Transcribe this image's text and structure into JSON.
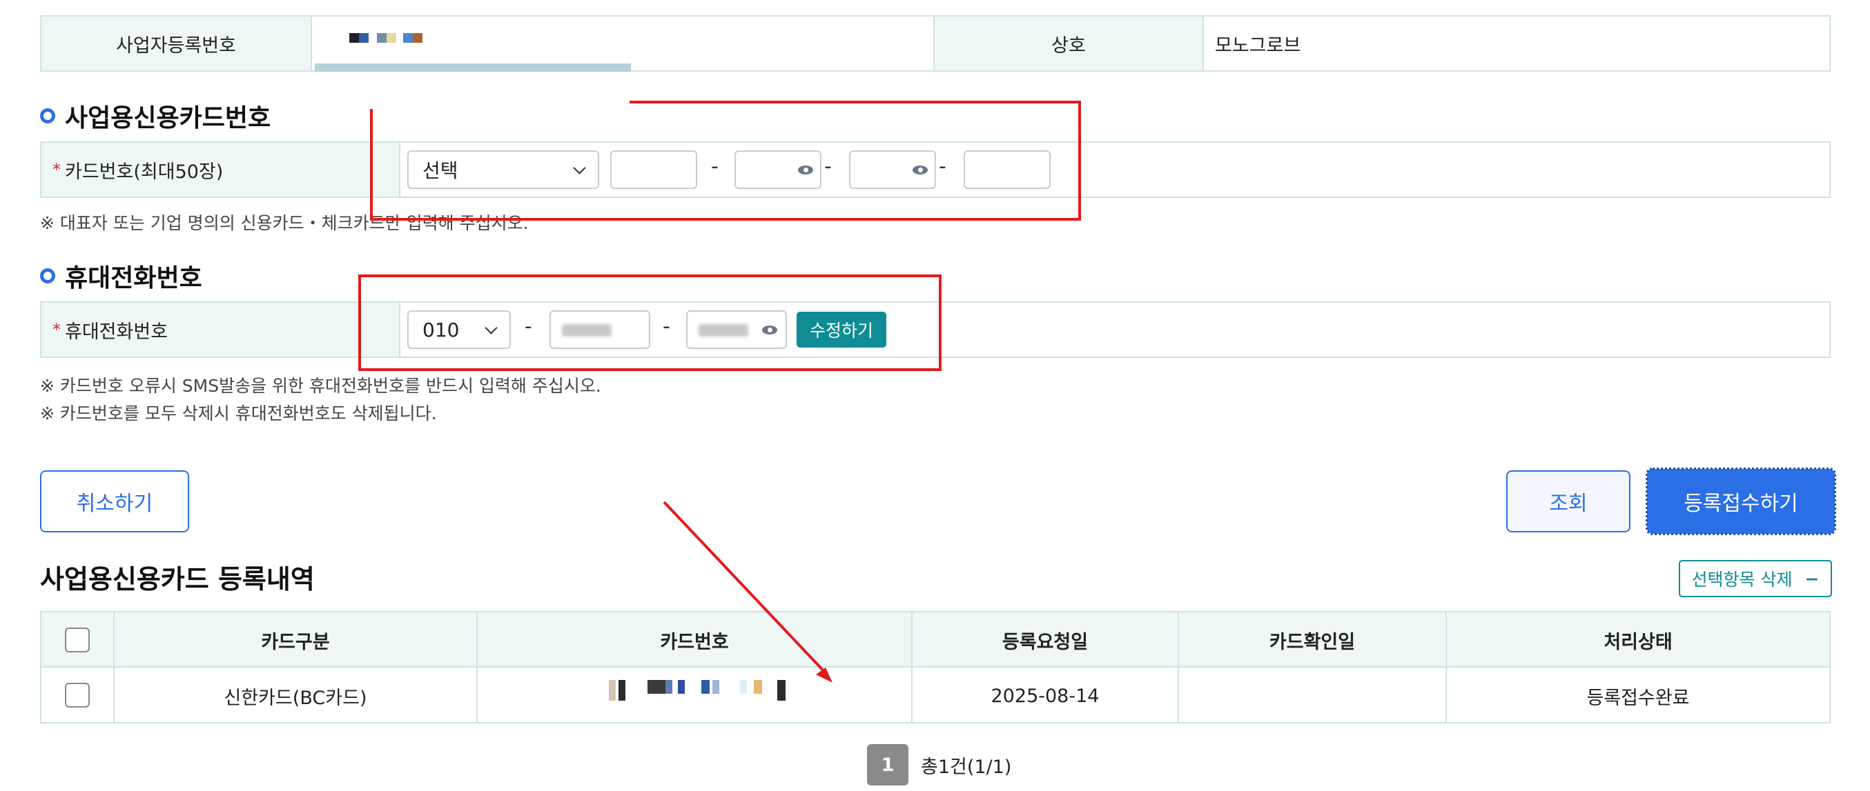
{
  "business_info": {
    "reg_no_label": "사업자등록번호",
    "company_label": "상호",
    "company_value": "모노그로브"
  },
  "card_section": {
    "title": "사업용신용카드번호",
    "field_label": "카드번호(최대50장)",
    "select_value": "선택",
    "dash": "-",
    "note": "※ 대표자 또는 기업 명의의 신용카드・체크카드만 입력해 주십시오."
  },
  "phone_section": {
    "title": "휴대전화번호",
    "field_label": "휴대전화번호",
    "prefix_value": "010",
    "dash": "-",
    "edit_button": "수정하기",
    "notes": [
      "※ 카드번호 오류시 SMS발송을 위한 휴대전화번호를 반드시 입력해 주십시오.",
      "※ 카드번호를 모두 삭제시 휴대전화번호도 삭제됩니다."
    ]
  },
  "actions": {
    "cancel": "취소하기",
    "search": "조회",
    "submit": "등록접수하기"
  },
  "list_section": {
    "title": "사업용신용카드 등록내역",
    "delete_selected": "선택항목 삭제",
    "delete_icon": "−",
    "columns": [
      "카드구분",
      "카드번호",
      "등록요청일",
      "카드확인일",
      "처리상태"
    ],
    "rows": [
      {
        "card_type": "신한카드(BC카드)",
        "card_number": "",
        "request_date": "2025-08-14",
        "confirm_date": "",
        "status": "등록접수완료"
      }
    ]
  },
  "pagination": {
    "current_page": "1",
    "summary": "총1건(1/1)"
  },
  "colors": {
    "primary_blue": "#2b6fe6",
    "teal_button": "#0f8c96",
    "annotation_red": "#e41a1a",
    "header_bg": "#eef7f6",
    "table_border": "#cfe3e2"
  }
}
